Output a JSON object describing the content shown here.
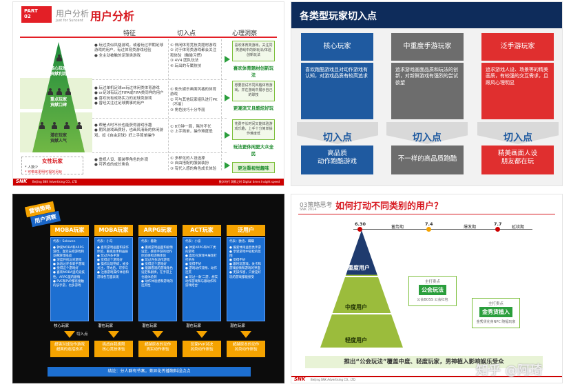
{
  "s1": {
    "part": "PART",
    "part_num": "02",
    "sub_title": "用户分析",
    "sub_small": "Just for Suncent",
    "title": "用户分析",
    "headers": [
      "特征",
      "切入点",
      "心理洞察"
    ],
    "levels": [
      {
        "name": "核心玩家",
        "sub": "贡献利润",
        "features": "● 玩过类似风格游戏，或者玩过早期足球游戏的用户，有过体育类游戏经验\n● 全主动被触的足球类游戏",
        "entry": "① 休闲体育竞技类题材游戏\n② 对于体育类游戏都会关注和体验（触碰习惯）\n③ 4V4 团队玩法\n④ 玩出的专属技技",
        "insight": "喜欢体育类游戏，关注同类游戏中的新玩法/体验创新玩法",
        "insight_label": "喜欢体育题材创新玩法"
      },
      {
        "name": "重点玩家",
        "sub": "贡献口碑",
        "features": "● 玩过单机足球or玩过休闲类体育游戏\n● or足球有玩过FIFA或FIFA类同样的用户\n● 喜欢玩有成熟实力的足球类游戏\n● 曾经关注过足球赛事的用户",
        "entry": "① 街头娱乐画面风格的体育游戏\n② 可与其他玩家组队进行PK（不用）\n③ 角色技巧十分华丽",
        "insight": "想要尝试不同风格体育游戏，并在游戏中展示自己的球技",
        "insight_label": "更潮流又且酷炫好玩"
      },
      {
        "name": "潜在玩家",
        "sub": "贡献人气",
        "features": "● 帮是占时不长也能获得游戏乐趣\n● 期风游戏画质好，也画风清新的休闲游戏，如《自由足球》好上手简单操作",
        "entry": "① 8分钟一局，耗时不长\n② 上手简单，操作难度低",
        "insight": "花费不长时间又能体验游戏乐趣，上手十分简单操作难度低",
        "insight_label": "玩法更休闲更大众全民"
      },
      {
        "name": "女性玩家",
        "sub": "",
        "features": "● 重视人设、服装等角色的外观\n● 可养成的成长角色",
        "entry": "① 多样化的人设选择\n② 自由搭配的服装装扮\n③ 有代入感的角色成长体验",
        "insight": "",
        "insight_label": "更注重视觉趣味"
      }
    ],
    "female_notes": [
      "* 人数少",
      "* 可带来更明可视的另玩"
    ],
    "footer": "Beijing SNK Advertising CO., LTD",
    "footer_right": "数字时代 洞察之时 Digital times Insight speed",
    "logo": "SNK"
  },
  "s2": {
    "title": "各类型玩家切入点",
    "columns": [
      {
        "head": "核心玩家",
        "color": "#1f5aa0",
        "body": "喜欢跑酷游戏且对动作游戏有认知，对游戏品质有较高追求",
        "entry": "切入点",
        "foot": "高品质\n动作跑酷游戏"
      },
      {
        "head": "中重度手游玩家",
        "color": "#6d6d6d",
        "body": "追求游戏画面品质和玩法的创新，对新鲜游戏有强烈的尝试欲望",
        "entry": "切入点",
        "foot": "不一样的高品质跑酷"
      },
      {
        "head": "泛手游玩家",
        "color": "#e02f2f",
        "body": "追求游戏人设、场景等的精美画质，有较强的交互需求，且跟风心理明显",
        "entry": "切入点",
        "foot": "精美画面人设\n朋友都在玩"
      }
    ]
  },
  "s3": {
    "tag1": "营销策略",
    "tag2": "用户洞察",
    "headers": [
      "MOBA玩家",
      "MOBA玩家",
      "ARPG玩家",
      "ACT玩家",
      "泛用户"
    ],
    "reps": [
      "代表：Selewen",
      "代表：小马",
      "代表：着歌",
      "代表：小奋",
      "代表：欧洛、瞒瞒"
    ],
    "body": [
      "● 钟爱MOBA和ARPG游戏，喜欢去把游戏和竞赛游戏排战\n● 深度开机与对游戏\n● 体验过许多新手游戏\n● 觉得这个游戏好\n● 喜欢MOBA里的竞技性，ARPG里的剧情\n● PVE和PVP都有接触的该手游，也多游戏",
      "● 喜欢游戏画面和操作体验，重视总体和画质\n● 玩过许多手游\n● 觉得这个游戏好\n● 操作比较熟练，被多关注，开始后，可参与\n● 注意游戏操作体验和游戏各方面表现",
      "● 重视游戏画面和剧情设定，感受手游的动作体验感和流畅体验\n● 玩过许多动作游戏\n● 觉得这个游戏好\n● 能跟客观的游戏角色设定和剧情，在手游上也能体验到\n● 动作体验感和游戏的连贯性",
      "● 钟爱ARPG和ACT类的游戏\n● 喜欢在游戏中展现打打杀杀\n● 觉得不好\n● 游戏动作流畅、动作连贯\n● 玩过一款'二游，想实动作游戏和与跟动作和游戏结合'",
      "● 偏爱休闲益智类手游\n● 享受游戏中轻松的氛围\n● 觉得不好\n● 跟时玩游戏，关卡和游戏剧情和游戏的界面\n● 无操作感，只要是好玩的游戏都能接受"
    ],
    "labels": [
      "核心玩家",
      "潜在玩家",
      "潜在玩家",
      "潜在玩家",
      "潜在玩家"
    ],
    "entry": "切入点",
    "boxes": [
      "超强对战动作游戏\n超爽的连招技术",
      "挑战自我极限\n核心竞技体验",
      "超越原本的动作\n真实动作体验",
      "玩家PVP对决\n另类动作体验",
      "超越原本的动作\n另类动作体验"
    ],
    "bottom": "结论：分人群有节奏，差异化传播物料设点点"
  },
  "s4": {
    "section": "03策略思考",
    "section_sub": "SNK 2014",
    "title": "如何打动不同类别的用户？",
    "timeline": [
      {
        "date": "6.30",
        "label": "蓄势期"
      },
      {
        "date": "7.4",
        "label": "爆发期"
      },
      {
        "date": "7.7",
        "label": "延续期"
      }
    ],
    "levels": [
      "重度用户",
      "中度用户",
      "轻度用户"
    ],
    "bubble1_sub": "主打卖点",
    "bubble1": "公会玩法",
    "bubble1_notes": "公会BOSS   公会红包",
    "bubble2_sub": "主打卖点",
    "bubble2": "金秀货植入",
    "bubble2_notes": "金秀货化身NPC  随幅玩家",
    "bottom": "推出“公会玩法”覆盖中度、轻度玩家，男神植入影响娱乐受众",
    "watermark": "知乎 @阿琦",
    "footer": "Beijing SNK Advertising CO., LTD",
    "logo": "SNK"
  }
}
